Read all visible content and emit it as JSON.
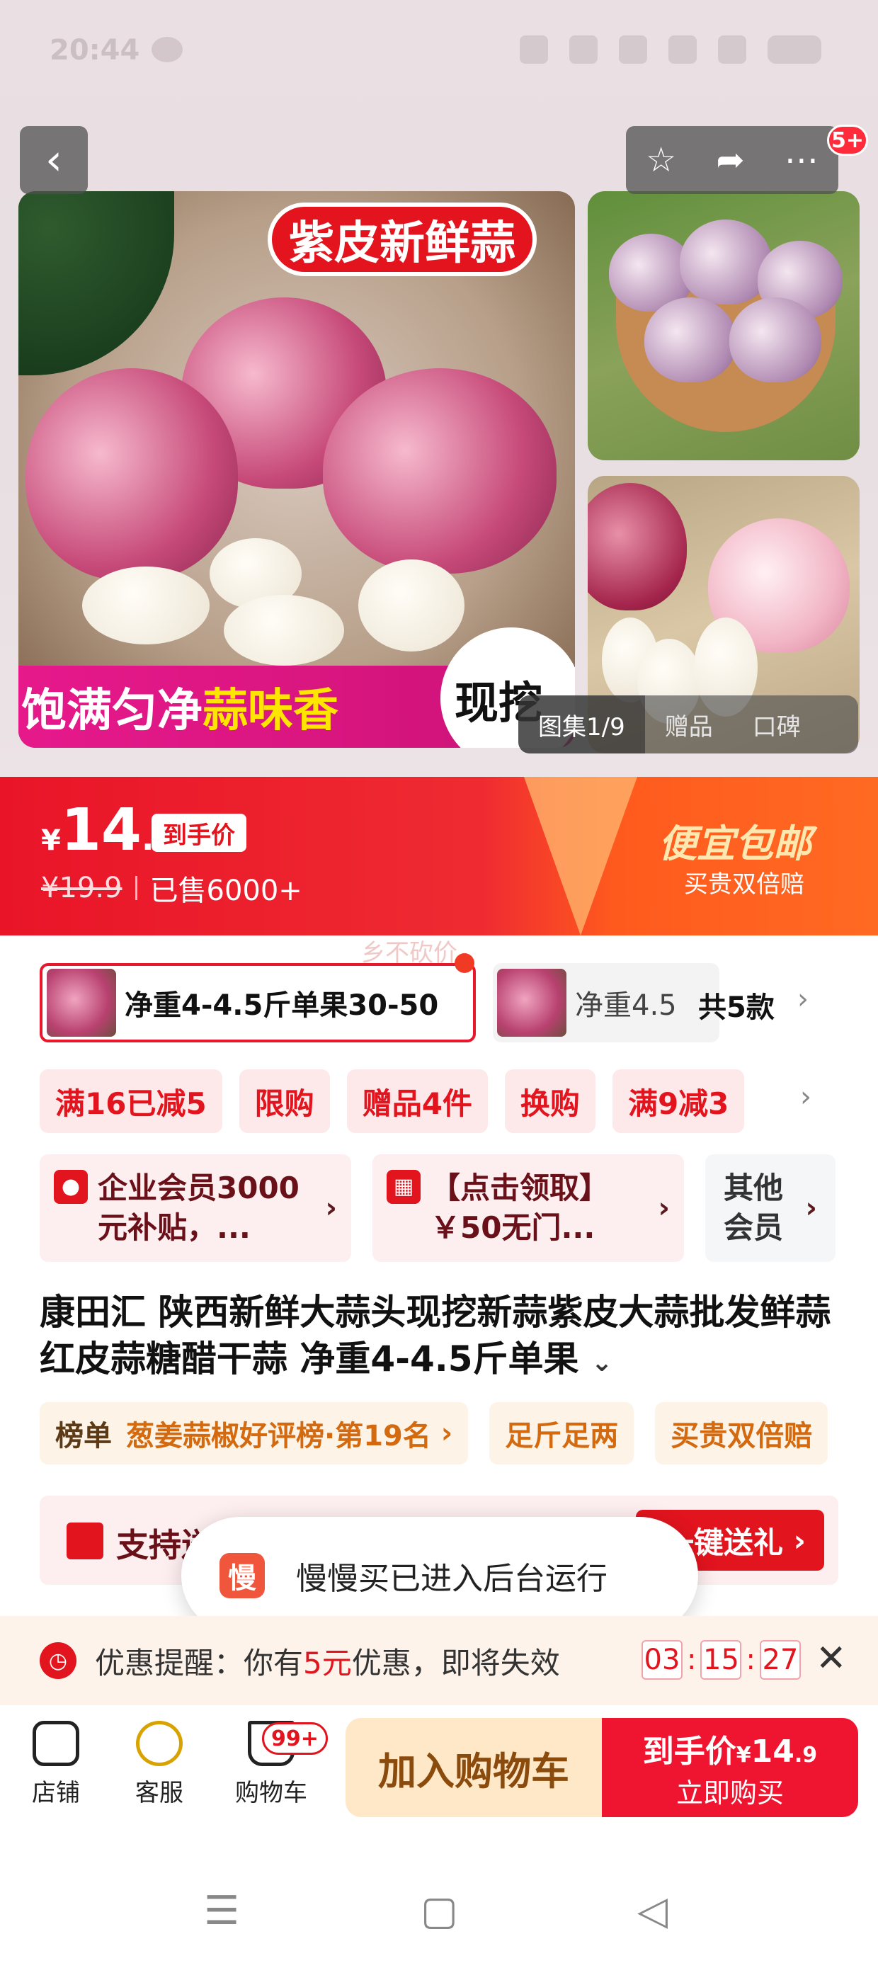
{
  "status_bar": {
    "time": "20:44"
  },
  "header": {
    "message_badge": "5+"
  },
  "gallery": {
    "main_badge": "紫皮新鲜蒜",
    "main_strip_a": "饱满匀净",
    "main_strip_highlight": "蒜味香",
    "main_strip_b": "现挖",
    "tab_gallery": "图集1/9",
    "tab_gift": "赠品",
    "tab_reviews": "口碑"
  },
  "price": {
    "currency": "¥",
    "integer": "14",
    "decimal": ".9",
    "tag": "到手价",
    "original": "¥19.9",
    "sold": "已售6000+",
    "free_shipping": "便宜包邮",
    "compensation": "买贵双倍赔"
  },
  "watermark": "乡不砍价",
  "specs": {
    "selected": "净重4-4.5斤单果30-50",
    "other": "净重4.5",
    "count": "共5款"
  },
  "coupons": [
    "满16已减5",
    "限购",
    "赠品4件",
    "换购",
    "满9减3"
  ],
  "members": {
    "enterprise": "企业会员3000元补贴，...",
    "coupon_claim": "【点击领取】￥50无门...",
    "other": "其他会员"
  },
  "product_title": "康田汇 陕西新鲜大蒜头现挖新蒜紫皮大蒜批发鲜蒜红皮蒜糖醋干蒜 净重4-4.5斤单果",
  "rank": {
    "label": "榜单",
    "text": "葱姜蒜椒好评榜·第19名",
    "tag1": "足斤足两",
    "tag2": "买贵双倍赔"
  },
  "gift": {
    "text": "支持送",
    "button": "一键送礼"
  },
  "toast": {
    "app_label": "慢",
    "text": "慢慢买已进入后台运行"
  },
  "reminder": {
    "prefix": "优惠提醒：你有",
    "amount": "5元",
    "suffix": "优惠，即将失效",
    "hh": "03",
    "mm": "15",
    "ss": "27"
  },
  "action_bar": {
    "shop": "店铺",
    "service": "客服",
    "cart": "购物车",
    "cart_badge": "99+",
    "add_to_cart": "加入购物车",
    "buy_price_label": "到手价",
    "buy_price_cur": "¥",
    "buy_price_int": "14",
    "buy_price_dec": ".9",
    "buy_now": "立即购买"
  },
  "colors": {
    "accent": "#e2141e",
    "promo_pink": "#e6198b",
    "orange": "#ff6a22"
  }
}
